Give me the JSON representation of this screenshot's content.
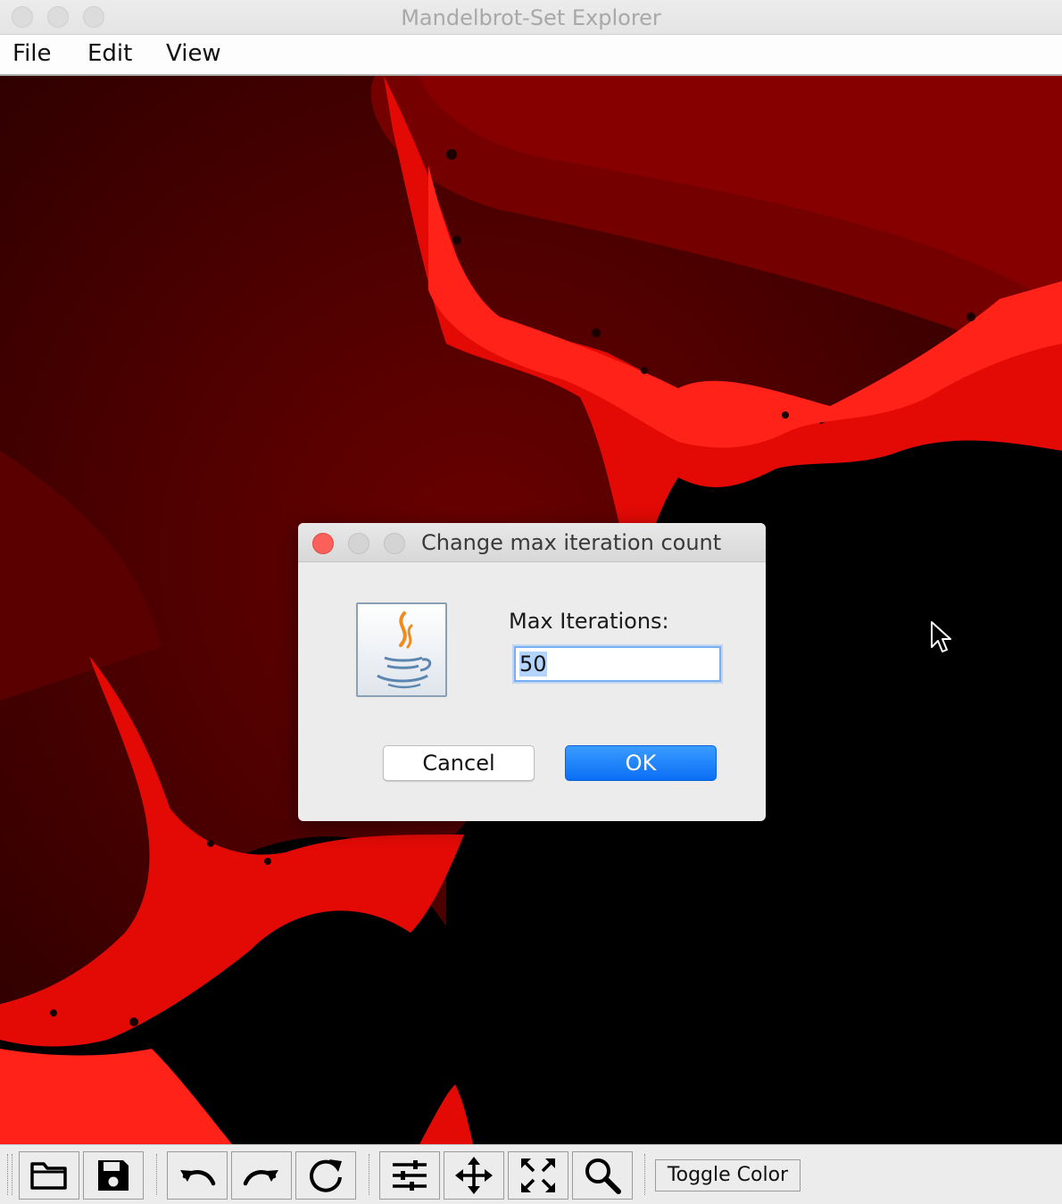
{
  "window": {
    "title": "Mandelbrot-Set Explorer"
  },
  "menu": {
    "items": [
      "File",
      "Edit",
      "View"
    ]
  },
  "toolbar": {
    "buttons": [
      "open-folder-icon",
      "save-icon",
      "undo-icon",
      "redo-icon",
      "refresh-icon",
      "settings-sliders-icon",
      "move-icon",
      "fit-expand-icon",
      "zoom-icon"
    ],
    "toggle_label": "Toggle Color"
  },
  "dialog": {
    "title": "Change max iteration count",
    "icon": "java-icon",
    "field_label": "Max Iterations:",
    "field_value": "50",
    "cancel_label": "Cancel",
    "ok_label": "OK"
  },
  "colors": {
    "fractal_red": "#ff1a10",
    "ok_blue": "#0a6ff5",
    "close_red": "#fc605b"
  }
}
